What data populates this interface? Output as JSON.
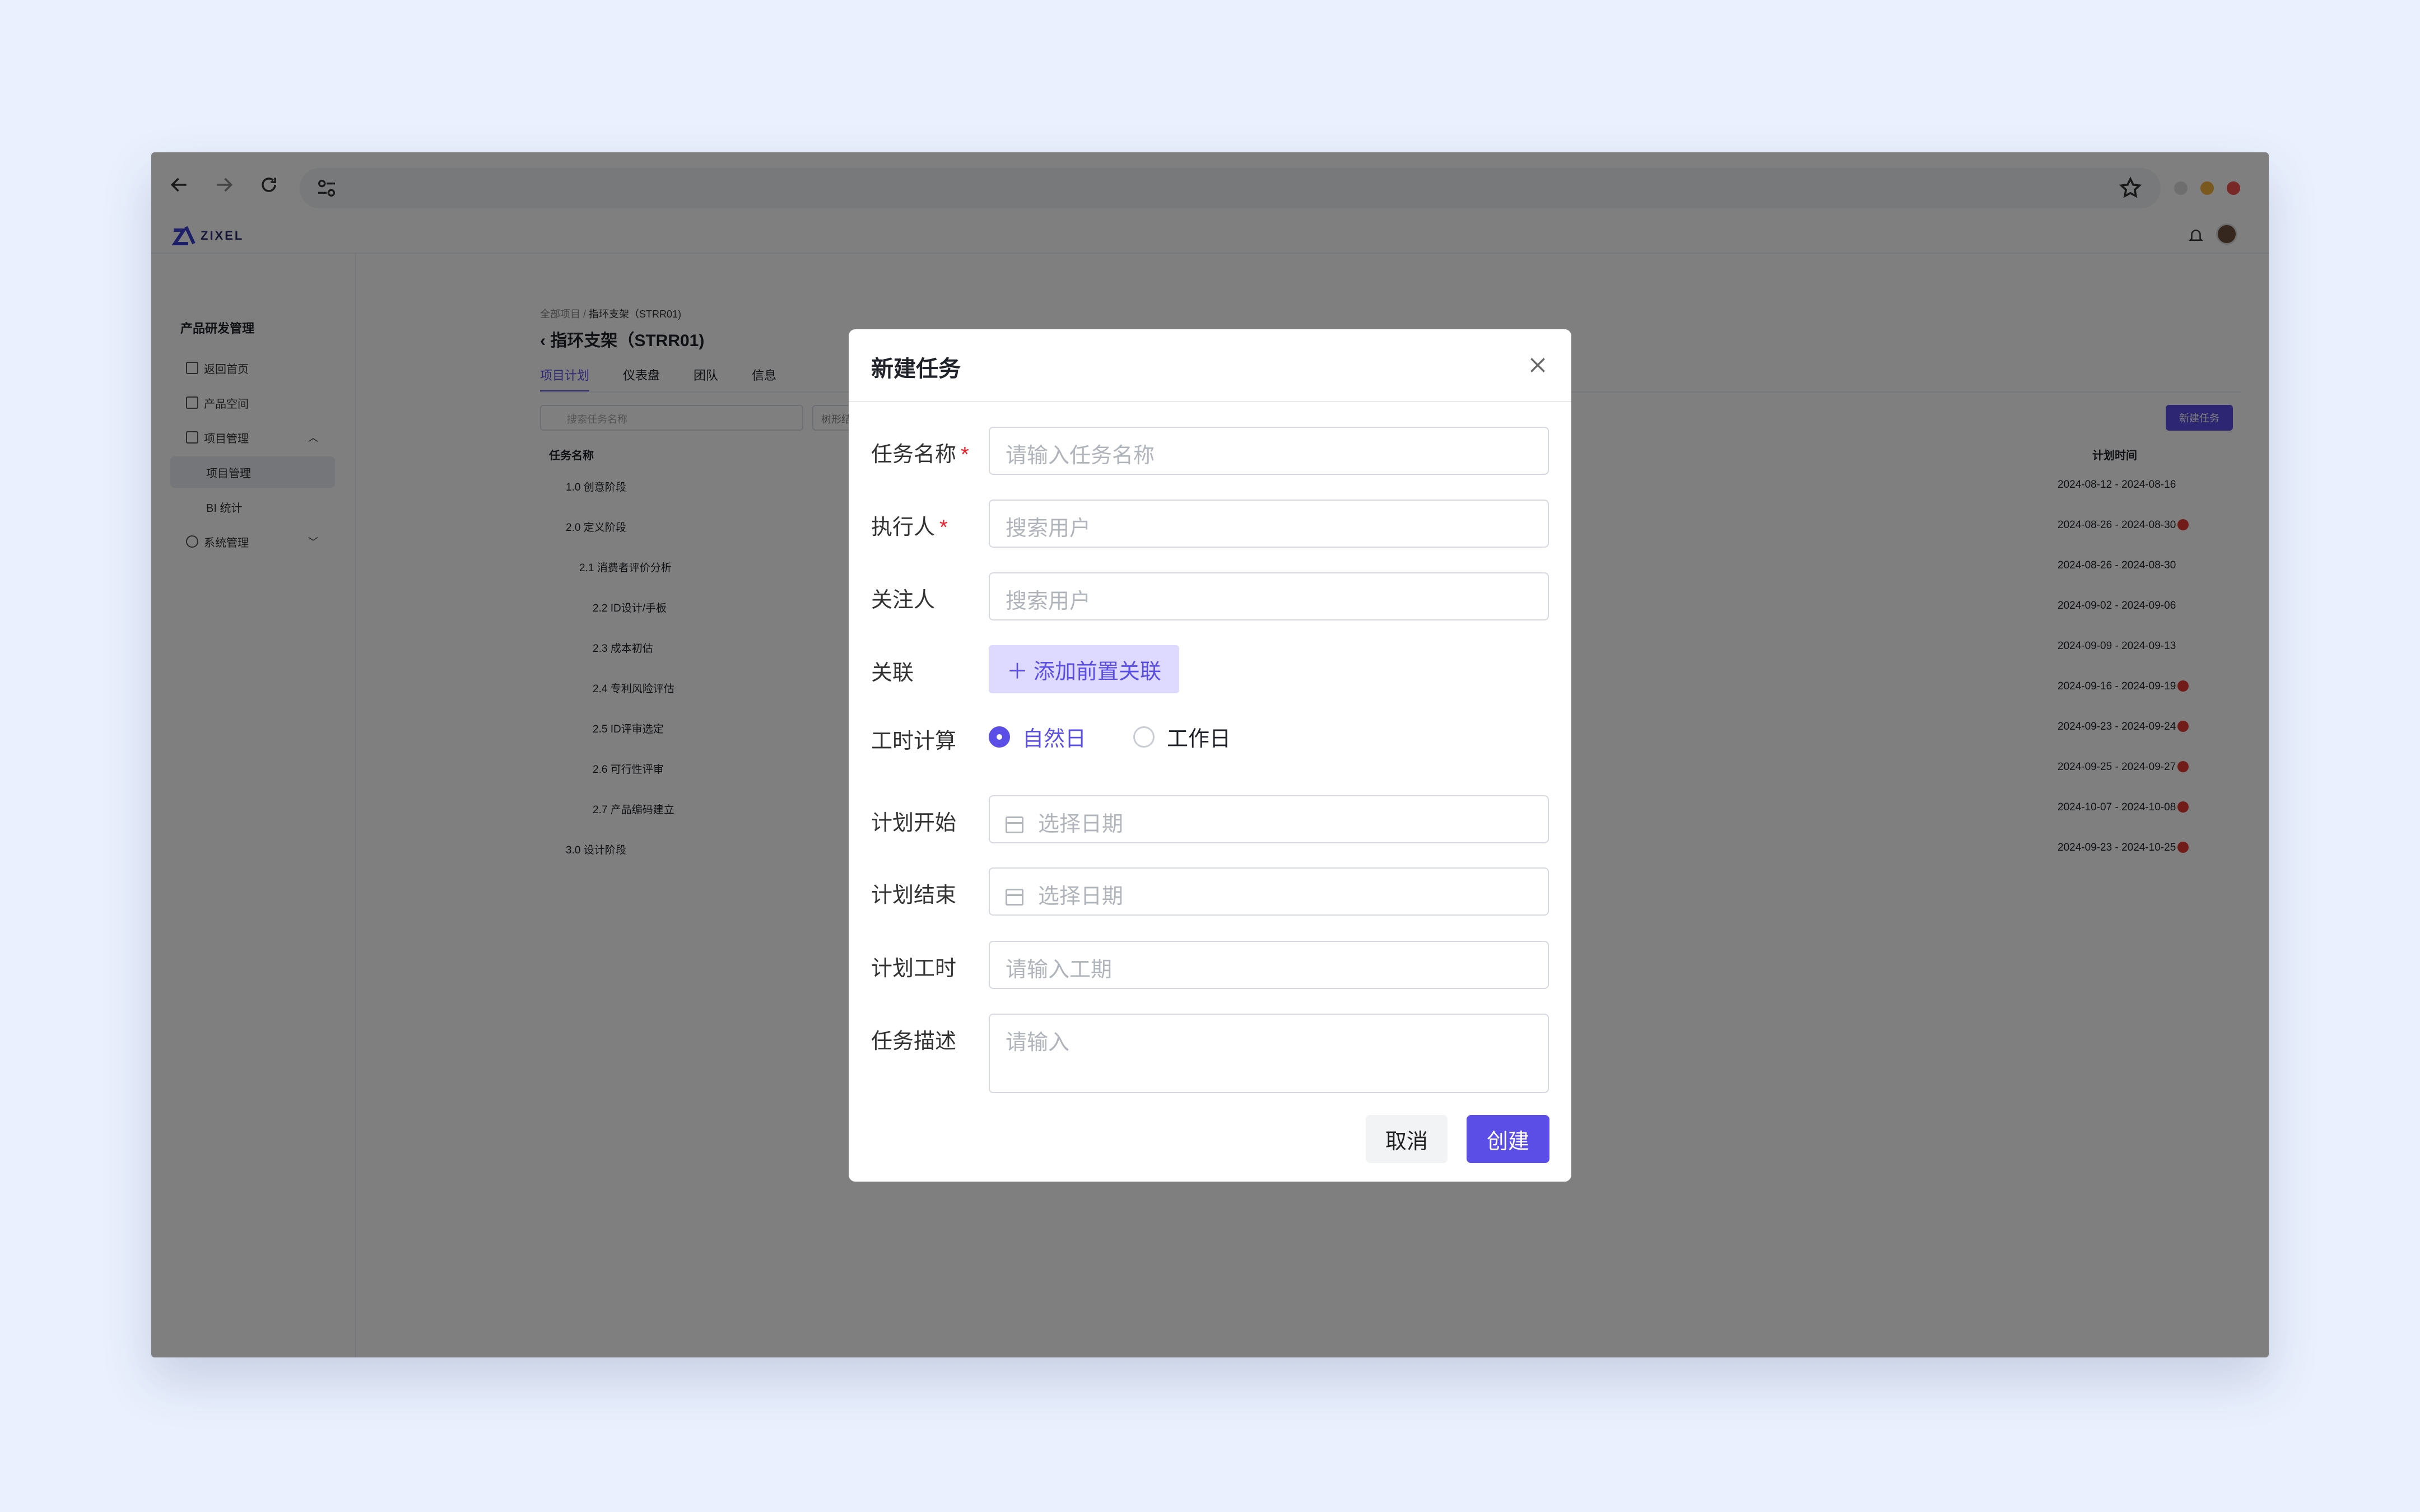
{
  "app": {
    "logo_text": "ZIXEL",
    "sidebar": {
      "title": "产品研发管理",
      "items": [
        {
          "label": "返回首页"
        },
        {
          "label": "产品空间"
        },
        {
          "label": "项目管理"
        },
        {
          "label": "项目管理"
        },
        {
          "label": "BI 统计"
        },
        {
          "label": "系统管理"
        }
      ]
    },
    "breadcrumb": {
      "root": "全部项目",
      "sep": "/",
      "current": "指环支架（STRR01)"
    },
    "page_title": "指环支架（STRR01)",
    "tabs": [
      "项目计划",
      "仪表盘",
      "团队",
      "信息"
    ],
    "search_placeholder": "搜索任务名称",
    "view_select": "树形结构",
    "new_task_button": "新建任务",
    "table": {
      "col_name": "任务名称",
      "col_date": "计划时间",
      "rows": [
        {
          "name": "1.0 创意阶段",
          "dates": "2024-08-12 - 2024-08-16",
          "warn": false
        },
        {
          "name": "2.0 定义阶段",
          "dates": "2024-08-26 - 2024-08-30",
          "warn": true
        },
        {
          "name": "2.1 消费者评价分析",
          "dates": "2024-08-26 - 2024-08-30",
          "warn": false
        },
        {
          "name": "2.2 ID设计/手板",
          "dates": "2024-09-02 - 2024-09-06",
          "warn": false
        },
        {
          "name": "2.3 成本初估",
          "dates": "2024-09-09 - 2024-09-13",
          "warn": false
        },
        {
          "name": "2.4 专利风险评估",
          "dates": "2024-09-16 - 2024-09-19",
          "warn": true
        },
        {
          "name": "2.5 ID评审选定",
          "dates": "2024-09-23 - 2024-09-24",
          "warn": true
        },
        {
          "name": "2.6 可行性评审",
          "dates": "2024-09-25 - 2024-09-27",
          "warn": true
        },
        {
          "name": "2.7 产品编码建立",
          "dates": "2024-10-07 - 2024-10-08",
          "warn": true
        },
        {
          "name": "3.0 设计阶段",
          "dates": "2024-09-23 - 2024-10-25",
          "warn": true
        }
      ]
    }
  },
  "modal": {
    "title": "新建任务",
    "fields": {
      "task_name": {
        "label": "任务名称",
        "placeholder": "请输入任务名称",
        "required": true
      },
      "assignee": {
        "label": "执行人",
        "placeholder": "搜索用户",
        "required": true
      },
      "followers": {
        "label": "关注人",
        "placeholder": "搜索用户"
      },
      "relation": {
        "label": "关联",
        "button": "添加前置关联"
      },
      "work_calc": {
        "label": "工时计算",
        "options": [
          "自然日",
          "工作日"
        ],
        "selected": "自然日"
      },
      "plan_start": {
        "label": "计划开始",
        "placeholder": "选择日期"
      },
      "plan_end": {
        "label": "计划结束",
        "placeholder": "选择日期"
      },
      "plan_hours": {
        "label": "计划工时",
        "placeholder": "请输入工期"
      },
      "description": {
        "label": "任务描述",
        "placeholder": "请输入"
      }
    },
    "cancel": "取消",
    "create": "创建"
  },
  "colors": {
    "accent": "#5b4ee6",
    "required": "#f5222d",
    "page_bg": "#eaf0fd"
  },
  "icons": [
    "back-arrow-icon",
    "forward-arrow-icon",
    "reload-icon",
    "site-settings-icon",
    "bookmark-star-icon",
    "bell-icon",
    "close-icon",
    "calendar-icon",
    "plus-icon"
  ]
}
